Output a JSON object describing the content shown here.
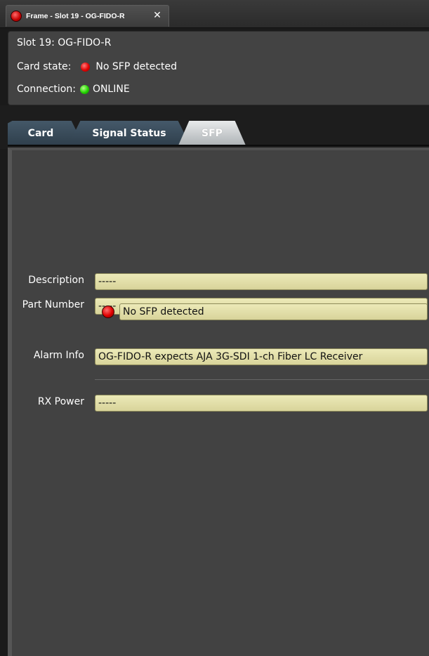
{
  "window": {
    "tab_title": "Frame - Slot 19 - OG-FIDO-R",
    "tab_icon": "record-icon",
    "close_symbol": "✕"
  },
  "info": {
    "slot_text": "Slot 19: OG-FIDO-R",
    "card_state_label": "Card state:",
    "card_state_value": "No SFP detected",
    "card_state_color": "#e00000",
    "connection_label": "Connection:",
    "connection_value": "ONLINE",
    "connection_color": "#22d400"
  },
  "tabs": [
    {
      "label": "Card",
      "active": false
    },
    {
      "label": "Signal Status",
      "active": false
    },
    {
      "label": "SFP",
      "active": true
    }
  ],
  "sfp": {
    "description_label": "Description",
    "description_value": "-----",
    "part_number_label": "Part Number",
    "part_number_value": "-----",
    "alarm_status_value": "No SFP detected",
    "alarm_status_color": "#e00000",
    "alarm_info_label": "Alarm Info",
    "alarm_info_value": "OG-FIDO-R expects AJA 3G-SDI 1-ch Fiber LC Receiver",
    "rx_power_label": "RX Power",
    "rx_power_value": "-----"
  },
  "colors": {
    "field_background": "#e4e1a8",
    "panel_background": "#424242",
    "tab_inactive": "#3a4b59",
    "tab_active": "#d0d3d5"
  }
}
